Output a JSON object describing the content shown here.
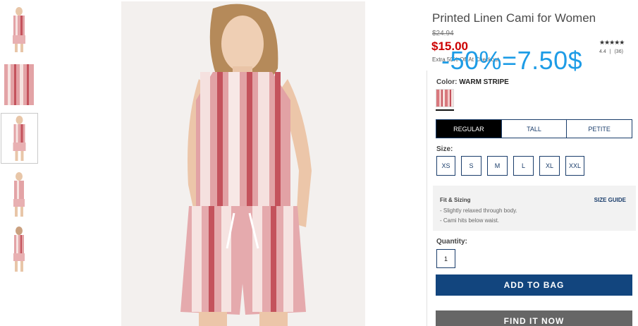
{
  "product": {
    "title": "Printed Linen Cami for Women",
    "old_price": "$24.94",
    "price": "$15.00",
    "extra_off": "Extra 50% Off At Checkout",
    "overlay_text": "-50%=7.50$",
    "stars": "★★★★★",
    "rating_value": "4.4",
    "rating_sep": "|",
    "rating_count": "(36)"
  },
  "color": {
    "label": "Color:",
    "value": "WARM STRIPE",
    "swatch_color": "#d9787d"
  },
  "fit_tabs": [
    {
      "label": "REGULAR",
      "active": true
    },
    {
      "label": "TALL",
      "active": false
    },
    {
      "label": "PETITE",
      "active": false
    }
  ],
  "size": {
    "label": "Size:",
    "options": [
      "XS",
      "S",
      "M",
      "L",
      "XL",
      "XXL"
    ]
  },
  "fit_sizing": {
    "title": "Fit & Sizing",
    "lines": [
      "- Slightly relaxed through body.",
      "- Cami hits below waist."
    ],
    "size_guide": "SIZE GUIDE"
  },
  "quantity": {
    "label": "Quantity:",
    "value": "1"
  },
  "buttons": {
    "add_to_bag": "ADD TO BAG",
    "find_it_now": "FIND IT NOW"
  },
  "colors": {
    "accent": "#12457e",
    "price_red": "#cc0000",
    "overlay_blue": "#1e9ce6"
  }
}
